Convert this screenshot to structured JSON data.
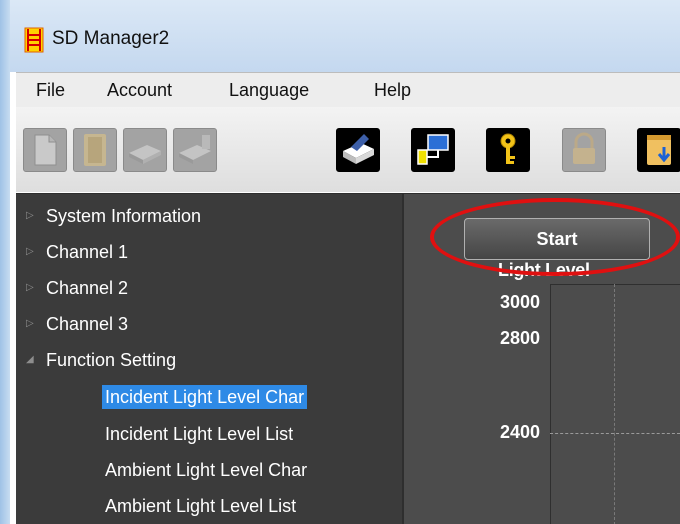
{
  "window": {
    "title": "SD Manager2"
  },
  "menu": {
    "items": [
      "File",
      "Account",
      "Language",
      "Help"
    ]
  },
  "toolbar": {
    "buttons": [
      {
        "icon": "new-document-icon",
        "enabled": false
      },
      {
        "icon": "open-folder-icon",
        "enabled": false
      },
      {
        "icon": "read-device-icon",
        "enabled": false
      },
      {
        "icon": "write-device-icon",
        "enabled": false
      },
      {
        "icon": "print-icon",
        "enabled": true
      },
      {
        "icon": "network-connection-icon",
        "enabled": true
      },
      {
        "icon": "key-icon",
        "enabled": true
      },
      {
        "icon": "lock-icon",
        "enabled": false
      },
      {
        "icon": "download-folder-icon",
        "enabled": true
      }
    ]
  },
  "tree": {
    "items": [
      {
        "label": "System Information",
        "expanded": false
      },
      {
        "label": "Channel 1",
        "expanded": false
      },
      {
        "label": "Channel 2",
        "expanded": false
      },
      {
        "label": "Channel 3",
        "expanded": false
      },
      {
        "label": "Function Setting",
        "expanded": true
      }
    ],
    "children": [
      {
        "label": "Incident Light Level Char",
        "selected": true
      },
      {
        "label": "Incident Light Level List",
        "selected": false
      },
      {
        "label": "Ambient Light Level Char",
        "selected": false
      },
      {
        "label": "Ambient Light Level List",
        "selected": false
      }
    ]
  },
  "chart_panel": {
    "start_label": "Start",
    "y_axis_title": "Light Level",
    "y_ticks": [
      "3000",
      "2800",
      "2400"
    ]
  },
  "colors": {
    "selection": "#2e8ae6",
    "highlight_annotation": "#e01010",
    "tree_background": "#3b3b3b",
    "chart_background": "#4c4c4c"
  }
}
